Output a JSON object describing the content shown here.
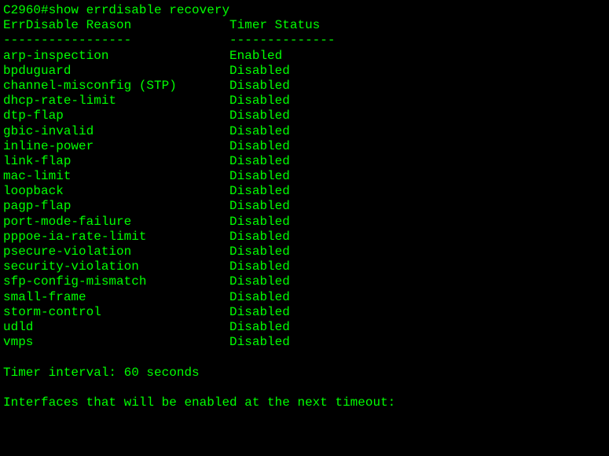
{
  "prompt": "C2960#",
  "command": "show errdisable recovery",
  "header_reason": "ErrDisable Reason",
  "header_timer": "Timer Status",
  "dash_left": "-----------------",
  "dash_right": "--------------",
  "rows": [
    {
      "reason": "arp-inspection",
      "status": "Enabled"
    },
    {
      "reason": "bpduguard",
      "status": "Disabled"
    },
    {
      "reason": "channel-misconfig (STP)",
      "status": "Disabled"
    },
    {
      "reason": "dhcp-rate-limit",
      "status": "Disabled"
    },
    {
      "reason": "dtp-flap",
      "status": "Disabled"
    },
    {
      "reason": "gbic-invalid",
      "status": "Disabled"
    },
    {
      "reason": "inline-power",
      "status": "Disabled"
    },
    {
      "reason": "link-flap",
      "status": "Disabled"
    },
    {
      "reason": "mac-limit",
      "status": "Disabled"
    },
    {
      "reason": "loopback",
      "status": "Disabled"
    },
    {
      "reason": "pagp-flap",
      "status": "Disabled"
    },
    {
      "reason": "port-mode-failure",
      "status": "Disabled"
    },
    {
      "reason": "pppoe-ia-rate-limit",
      "status": "Disabled"
    },
    {
      "reason": "psecure-violation",
      "status": "Disabled"
    },
    {
      "reason": "security-violation",
      "status": "Disabled"
    },
    {
      "reason": "sfp-config-mismatch",
      "status": "Disabled"
    },
    {
      "reason": "small-frame",
      "status": "Disabled"
    },
    {
      "reason": "storm-control",
      "status": "Disabled"
    },
    {
      "reason": "udld",
      "status": "Disabled"
    },
    {
      "reason": "vmps",
      "status": "Disabled"
    }
  ],
  "timer_interval": "Timer interval: 60 seconds",
  "interfaces_msg": "Interfaces that will be enabled at the next timeout:"
}
